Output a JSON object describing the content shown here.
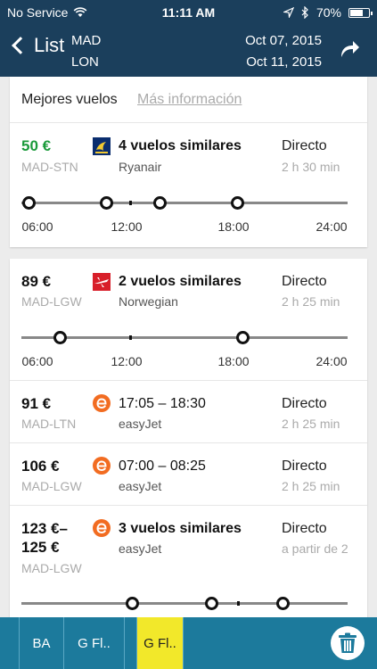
{
  "status_bar": {
    "carrier": "No Service",
    "time": "11:11 AM",
    "battery": "70%",
    "battery_level": 0.7
  },
  "nav": {
    "back_label": "List",
    "origin": "MAD",
    "destination": "LON",
    "depart_date": "Oct 07, 2015",
    "return_date": "Oct 11, 2015"
  },
  "best": {
    "title": "Mejores vuelos",
    "more_info": "Más información"
  },
  "flights": [
    {
      "price": "50 €",
      "route": "MAD-STN",
      "title": "4 vuelos similares",
      "airline": "Ryanair",
      "stops": "Directo",
      "duration": "2 h 30 min",
      "timeline_labels": [
        "06:00",
        "12:00",
        "18:00",
        "24:00"
      ]
    },
    {
      "price": "89 €",
      "route": "MAD-LGW",
      "title": "2 vuelos similares",
      "airline": "Norwegian",
      "stops": "Directo",
      "duration": "2 h 25 min",
      "timeline_labels": [
        "06:00",
        "12:00",
        "18:00",
        "24:00"
      ]
    },
    {
      "price": "91 €",
      "route": "MAD-LTN",
      "title": "17:05 – 18:30",
      "airline": "easyJet",
      "stops": "Directo",
      "duration": "2 h 25 min"
    },
    {
      "price": "106 €",
      "route": "MAD-LGW",
      "title": "07:00 – 08:25",
      "airline": "easyJet",
      "stops": "Directo",
      "duration": "2 h 25 min"
    },
    {
      "price_line1": "123 €–",
      "price_line2": "125 €",
      "route": "MAD-LGW",
      "title": "3 vuelos similares",
      "airline": "easyJet",
      "stops": "Directo",
      "duration": "a partir de 2"
    }
  ],
  "bottom_tabs": [
    "BA",
    "G Fl..",
    "G Fl.."
  ],
  "icons": {
    "wifi": "wifi-icon",
    "location": "location-arrow-icon",
    "bluetooth": "bluetooth-icon",
    "battery": "battery-icon",
    "back": "chevron-left-icon",
    "share": "share-arrow-icon",
    "trash": "trash-icon"
  },
  "colors": {
    "header": "#1b3f5c",
    "bottom_bar": "#1c7a9c",
    "active_tab": "#f2e82a",
    "best_price": "#1a9a3a"
  }
}
